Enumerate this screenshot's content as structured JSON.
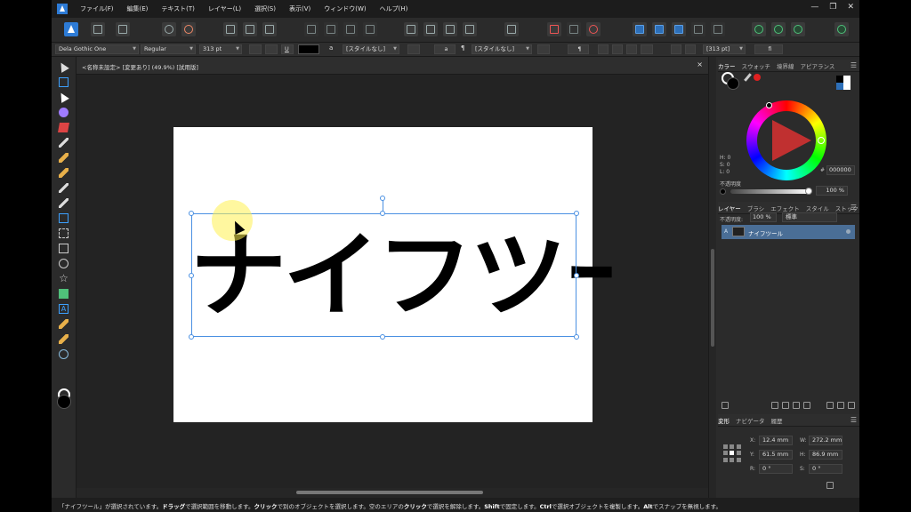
{
  "menu": [
    "ファイル(F)",
    "編集(E)",
    "テキスト(T)",
    "レイヤー(L)",
    "選択(S)",
    "表示(V)",
    "ウィンドウ(W)",
    "ヘルプ(H)"
  ],
  "context": {
    "font": "Dela Gothic One",
    "style": "Regular",
    "size": "313 pt",
    "underline": "U",
    "char_glyph": "a",
    "char_style": "[スタイルなし]",
    "para_glyph": "a",
    "para_mark": "¶",
    "para_style": "[スタイルなし]",
    "para_mark2": "¶",
    "leading": "[313 pt]",
    "ligature": "fi"
  },
  "document": {
    "tab_title": "<名称未設定> [変更あり] (49.9%) [試用版]",
    "close": "×"
  },
  "artwork": {
    "text": "ナイフツール"
  },
  "colors": {
    "fill": "#000000",
    "selection": "#4a90e2",
    "accent": "#2d7bd6",
    "layer_selected": "#4a6e96"
  },
  "color_panel": {
    "tabs": [
      "カラー",
      "スウォッチ",
      "境界線",
      "アピアランス"
    ],
    "h": "H: 0",
    "s": "S: 0",
    "l": "L: 0",
    "hex_label": "#",
    "hex": "000000",
    "opacity_label": "不透明度",
    "opacity": "100 %",
    "opacity_fraction": 1.0
  },
  "layers_panel": {
    "tabs": [
      "レイヤー",
      "ブラシ",
      "エフェクト",
      "スタイル",
      "ストック"
    ],
    "opacity_label": "不透明度:",
    "opacity": "100 %",
    "blend": "標準",
    "layer_mark": "A",
    "layer_name": "ナイフツール"
  },
  "transform_panel": {
    "tabs": [
      "変形",
      "ナビゲータ",
      "履歴"
    ],
    "x_label": "X:",
    "x": "12.4 mm",
    "w_label": "W:",
    "w": "272.2 mm",
    "y_label": "Y:",
    "y": "61.5 mm",
    "h_label": "H:",
    "h": "86.9 mm",
    "r_label": "R:",
    "r": "0 °",
    "s_label": "S:",
    "s": "0 °"
  },
  "window_controls": [
    "—",
    "❐",
    "✕"
  ],
  "status": [
    {
      "t": "「ナイフツール」が選択されています。",
      "b": false
    },
    {
      "t": "ドラッグ",
      "b": true
    },
    {
      "t": "で選択範囲を移動します。",
      "b": false
    },
    {
      "t": "クリック",
      "b": true
    },
    {
      "t": "で別のオブジェクトを選択します。空のエリアの",
      "b": false
    },
    {
      "t": "クリック",
      "b": true
    },
    {
      "t": "で選択を解除します。",
      "b": false
    },
    {
      "t": "Shift",
      "b": true
    },
    {
      "t": "で固定します。",
      "b": false
    },
    {
      "t": "Ctrl",
      "b": true
    },
    {
      "t": "で選択オブジェクトを複製します。",
      "b": false
    },
    {
      "t": "Alt",
      "b": true
    },
    {
      "t": "でスナップを無視します。",
      "b": false
    }
  ]
}
